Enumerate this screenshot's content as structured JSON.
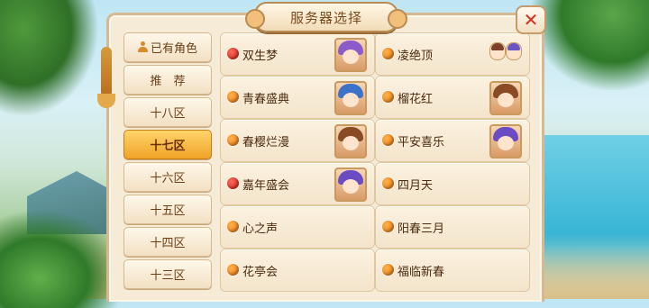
{
  "dialog": {
    "title": "服务器选择",
    "close_label": "✕"
  },
  "tabs": [
    {
      "label": "已有角色",
      "icon": "person-icon",
      "active": false
    },
    {
      "label": "推　荐",
      "active": false
    },
    {
      "label": "十八区",
      "active": false
    },
    {
      "label": "十七区",
      "active": true
    },
    {
      "label": "十六区",
      "active": false
    },
    {
      "label": "十五区",
      "active": false
    },
    {
      "label": "十四区",
      "active": false
    },
    {
      "label": "十三区",
      "active": false
    }
  ],
  "servers": [
    {
      "name": "双生梦",
      "status": "red",
      "avatar": "purple-hair-character"
    },
    {
      "name": "凌绝顶",
      "status": "orange",
      "avatar": "two-mini-characters"
    },
    {
      "name": "青春盛典",
      "status": "orange",
      "avatar": "blue-hair-character"
    },
    {
      "name": "榴花红",
      "status": "orange",
      "avatar": "brown-hair-character"
    },
    {
      "name": "春樱烂漫",
      "status": "orange",
      "avatar": "brown-hair-character"
    },
    {
      "name": "平安喜乐",
      "status": "orange",
      "avatar": "violet-hair-character"
    },
    {
      "name": "嘉年盛会",
      "status": "red",
      "avatar": "violet-hair-character"
    },
    {
      "name": "四月天",
      "status": "orange",
      "avatar": ""
    },
    {
      "name": "心之声",
      "status": "orange",
      "avatar": ""
    },
    {
      "name": "阳春三月",
      "status": "orange",
      "avatar": ""
    },
    {
      "name": "花亭会",
      "status": "orange",
      "avatar": ""
    },
    {
      "name": "福临新春",
      "status": "orange",
      "avatar": ""
    }
  ],
  "colors": {
    "status_red": "#c81d10",
    "status_orange": "#e07210",
    "active_tab": "#f0a428",
    "panel_bg": "#f6ebd6"
  }
}
